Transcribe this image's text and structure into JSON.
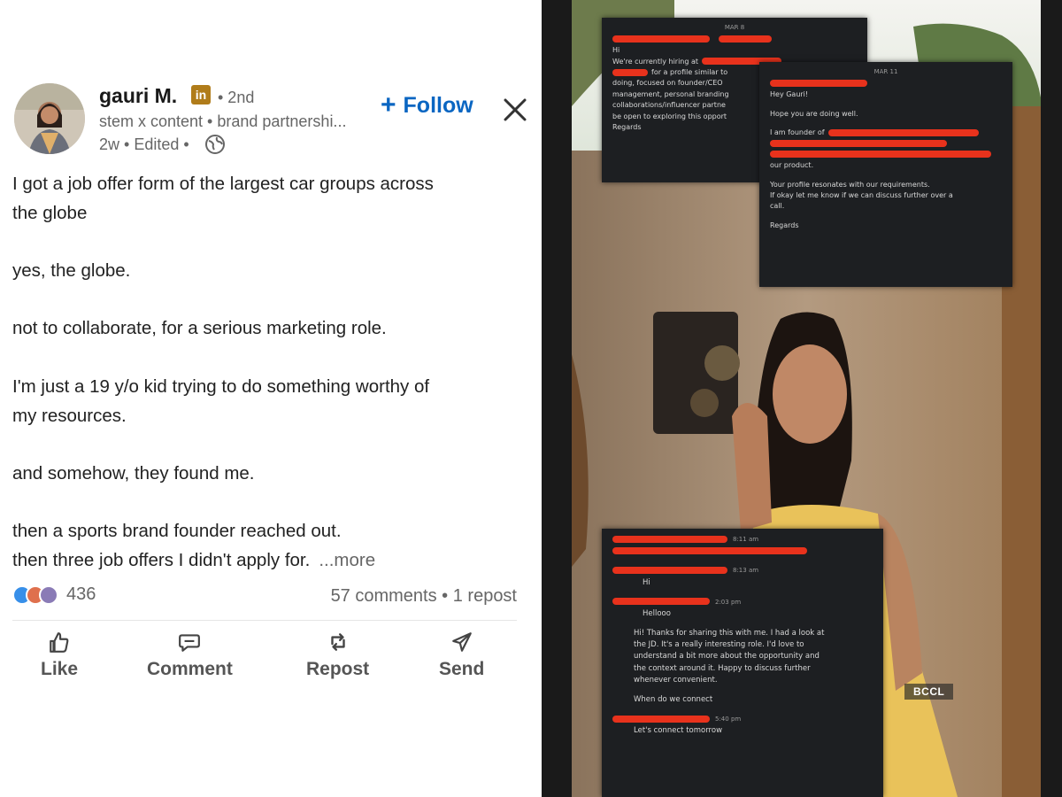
{
  "post": {
    "author": {
      "name": "gauri M.",
      "badge": "in",
      "degree": "• 2nd",
      "headline": "stem x content • brand partnershi...",
      "meta": "2w • Edited •"
    },
    "follow_label": "Follow",
    "body_lines": [
      "I got a job offer form of the largest car groups across",
      "the globe",
      "",
      "yes, the globe.",
      "",
      "not to collaborate, for a serious marketing role.",
      "",
      "I'm just a 19 y/o kid trying to do something worthy of",
      "my resources.",
      "",
      "and somehow, they found me.",
      "",
      "then a sports brand founder reached out."
    ],
    "last_line": "then three job offers I didn't apply for.",
    "more_label": "...more",
    "reaction_count": "436",
    "comments_reposts": "57 comments • 1 repost",
    "actions": {
      "like": "Like",
      "comment": "Comment",
      "repost": "Repost",
      "send": "Send"
    }
  },
  "photo": {
    "watermark": "BCCL",
    "card1": {
      "date": "MAR 8",
      "lines": [
        "Hi",
        "We're currently hiring at",
        "for a profile similar to",
        "doing, focused on founder/CEO",
        "management, personal branding",
        "collaborations/influencer partne",
        "be open to exploring this opport",
        "Regards"
      ]
    },
    "card2": {
      "date": "MAR 11",
      "lines": [
        "Hey Gauri!",
        "Hope you are doing well.",
        "I am founder of",
        "our product.",
        "Your profile resonates with our requirements.",
        "If okay let me know if we can discuss further over a",
        "call.",
        "Regards"
      ]
    },
    "card3": {
      "times": [
        "8:11 am",
        "8:13 am",
        "2:03 pm",
        "5:40 pm"
      ],
      "lines": [
        "Hi",
        "Hellooo",
        "Hi! Thanks for sharing this with me. I had a look at",
        "the JD. It's a really interesting role. I'd love to",
        "understand a bit more about the opportunity and",
        "the context around it. Happy to discuss further",
        "whenever convenient.",
        "When do we connect",
        "Let's connect tomorrow"
      ]
    }
  }
}
